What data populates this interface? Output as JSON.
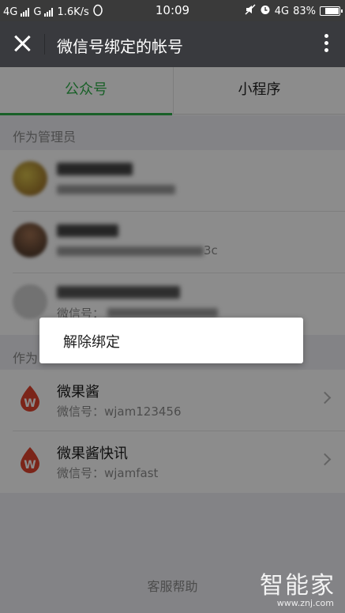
{
  "status_bar": {
    "network_1": "4G",
    "network_2": "G",
    "speed": "1.6K/s",
    "time": "10:09",
    "network_right": "4G",
    "battery": "83%",
    "battery_level": 0.83
  },
  "header": {
    "title": "微信号绑定的帐号"
  },
  "tabs": [
    {
      "label": "公众号",
      "active": true
    },
    {
      "label": "小程序",
      "active": false
    }
  ],
  "admin_section": {
    "title": "作为管理员",
    "rows": [
      {
        "name_blur": true,
        "sub_blur": true,
        "avatar_color": "#b38a3a"
      },
      {
        "name_blur": true,
        "sub_blur": true,
        "visible_suffix": "3c",
        "avatar_color": "#5e4b3b"
      },
      {
        "name_blur": true,
        "sub_prefix": "微信号：",
        "sub_blur": true,
        "avatar_color": "#c9c9c9"
      }
    ]
  },
  "operator_section": {
    "title": "作为",
    "rows": [
      {
        "name": "微果酱",
        "sub": "微信号：wjam123456"
      },
      {
        "name": "微果酱快讯",
        "sub": "微信号：wjamfast"
      }
    ]
  },
  "footer": {
    "help": "客服帮助"
  },
  "popup": {
    "item": "解除绑定"
  },
  "watermark": {
    "brand": "智能家",
    "url": "www.znj.com"
  },
  "colors": {
    "accent": "#2fb04a",
    "header_bg": "#393a3e",
    "icon_red": "#e0442e"
  }
}
